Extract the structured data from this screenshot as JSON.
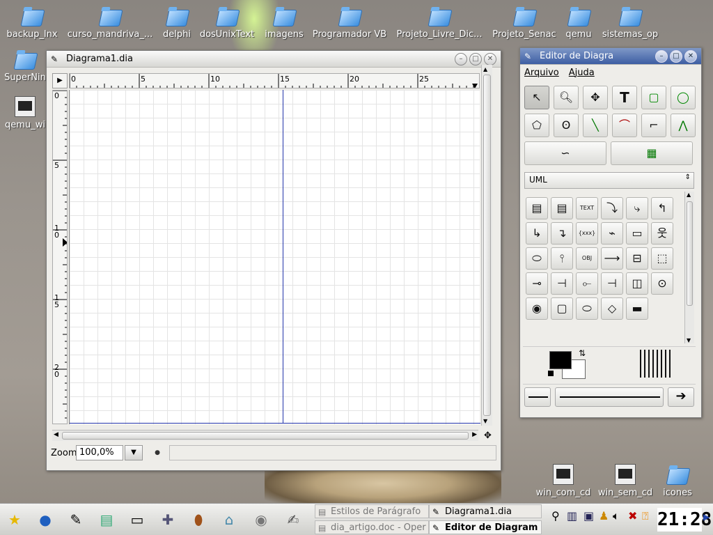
{
  "desktop": {
    "icons": [
      {
        "label": "backup_lnx",
        "icon": "folder-icon"
      },
      {
        "label": "curso_mandriva_...",
        "icon": "folder-icon"
      },
      {
        "label": "delphi",
        "icon": "folder-icon"
      },
      {
        "label": "dosUnixText",
        "icon": "folder-icon"
      },
      {
        "label": "imagens",
        "icon": "folder-icon"
      },
      {
        "label": "Programador VB",
        "icon": "folder-icon"
      },
      {
        "label": "Projeto_Livre_Dic...",
        "icon": "folder-icon"
      },
      {
        "label": "Projeto_Senac",
        "icon": "folder-icon"
      },
      {
        "label": "qemu",
        "icon": "folder-icon"
      },
      {
        "label": "sistemas_op",
        "icon": "folder-icon"
      },
      {
        "label": "SuperNin",
        "icon": "folder-icon"
      },
      {
        "label": "qemu_wi",
        "icon": "app-icon"
      },
      {
        "label": "win_com_cd",
        "icon": "terminal-icon"
      },
      {
        "label": "win_sem_cd",
        "icon": "terminal-icon"
      },
      {
        "label": "icones",
        "icon": "folder-icon"
      }
    ]
  },
  "diagram_window": {
    "title": "Diagrama1.dia",
    "ruler_h": [
      "0",
      "5",
      "10",
      "15",
      "20",
      "25"
    ],
    "ruler_v": [
      "0",
      "5",
      "1\n0",
      "1\n5",
      "2\n0"
    ],
    "zoom_label": "Zoom",
    "zoom_value": "100,0%"
  },
  "toolbox_window": {
    "title": "Editor de Diagra",
    "menu": [
      "Arquivo",
      "Ajuda"
    ],
    "sheet": "UML",
    "tools": [
      "pointer-tool",
      "magnify-tool",
      "move-tool",
      "text-tool",
      "box-tool",
      "ellipse-tool",
      "polygon-tool",
      "beziergon-tool",
      "line-tool",
      "arc-tool",
      "zigzag-tool",
      "polyline-tool",
      "bezier-tool",
      "image-tool"
    ],
    "shapes": [
      "class",
      "note-class",
      "text",
      "dependency",
      "realizes",
      "generalization",
      "association",
      "implements",
      "constraint",
      "small-package",
      "large-package",
      "actor",
      "usecase",
      "lifeline",
      "object",
      "message",
      "component",
      "node",
      "classicon",
      "state-term",
      "fork",
      "branch",
      "activity",
      "note",
      "initial",
      "state",
      "activity-state",
      "decision",
      "bar"
    ],
    "text_glyphs": {
      "text": "TEXT",
      "object": "OBJ",
      "constraint": "{xxx}"
    }
  },
  "taskbar": {
    "tasks": [
      {
        "label": "Estilos de Parágrafo",
        "active": false
      },
      {
        "label": "Diagrama1.dia",
        "active": false
      },
      {
        "label": "dia_artigo.doc - Oper",
        "active": false
      },
      {
        "label": "Editor de Diagram",
        "active": true
      }
    ],
    "clock": "21:28"
  },
  "colors": {
    "titlebar_active": "#3d5ea3",
    "page_break": "#2233aa",
    "folder": "#3b8fe0"
  }
}
